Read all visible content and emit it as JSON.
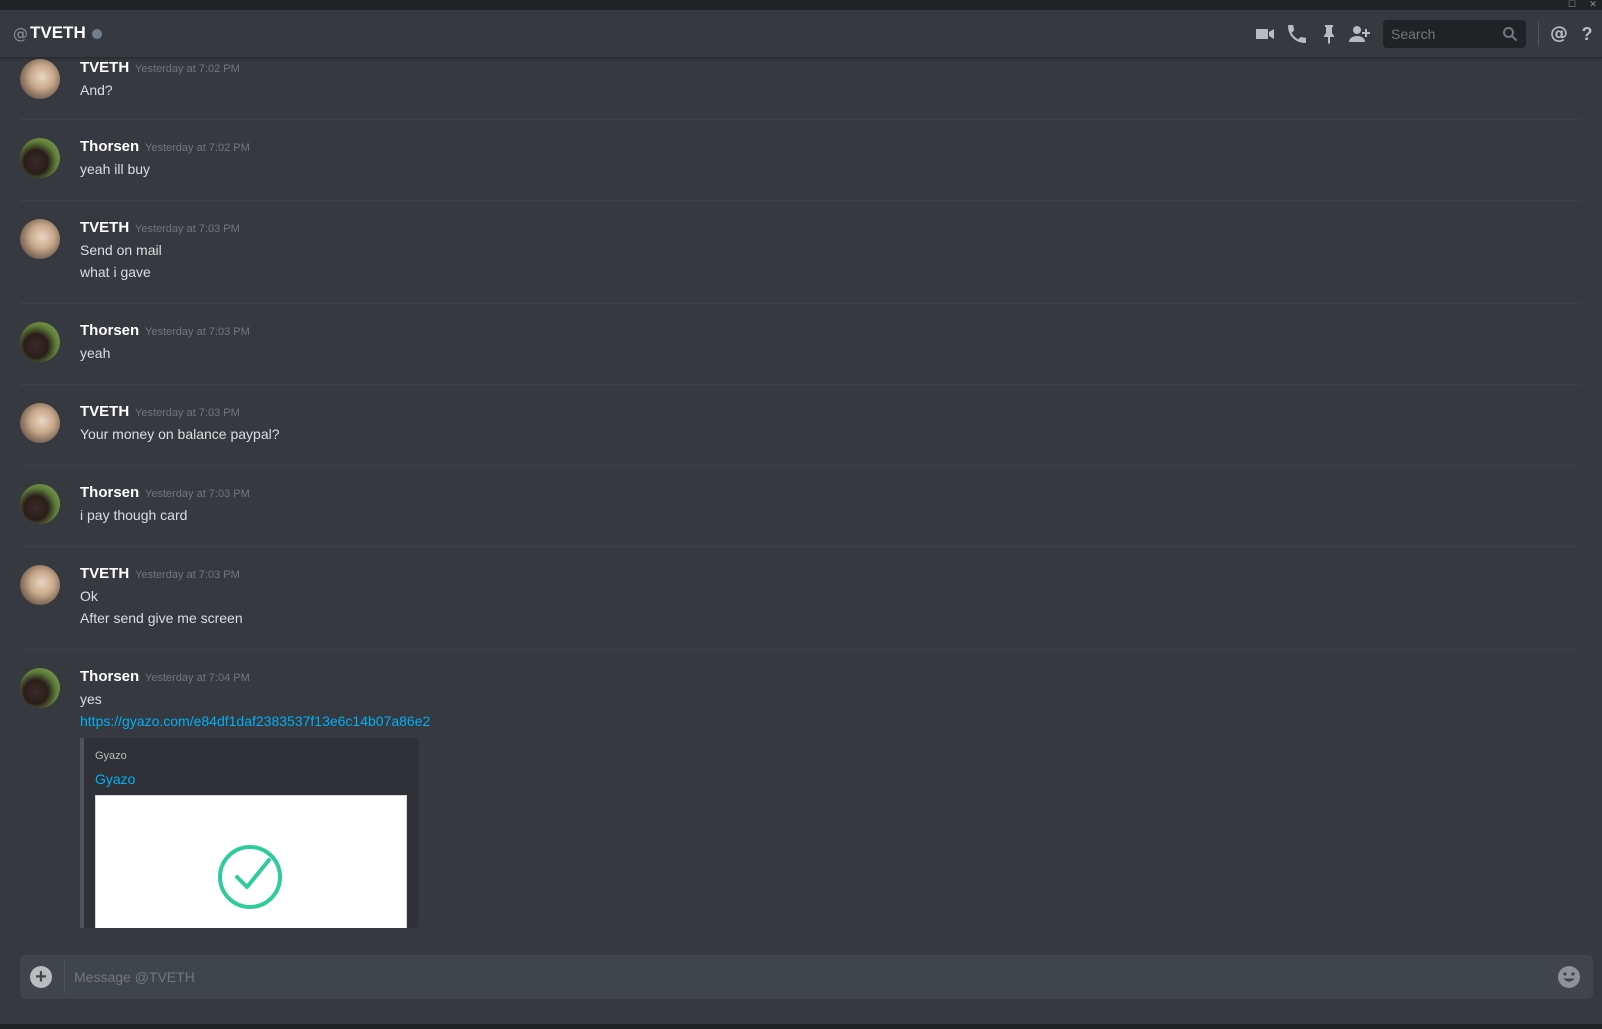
{
  "window": {
    "restore_glyph": "☐",
    "close_glyph": "✕"
  },
  "header": {
    "at_symbol": "@",
    "channel_name": "TVETH",
    "status_color": "#747f8d",
    "icons": [
      "video-call-icon",
      "voice-call-icon",
      "pin-icon",
      "add-friend-icon"
    ],
    "search_placeholder": "Search",
    "mention_symbol": "@",
    "help_symbol": "?"
  },
  "messages": [
    {
      "author": "TVETH",
      "avatar": "tveth",
      "timestamp": "Yesterday at 7:02 PM",
      "lines": [
        "And?"
      ]
    },
    {
      "author": "Thorsen",
      "avatar": "thorsen",
      "timestamp": "Yesterday at 7:02 PM",
      "lines": [
        "yeah ill buy"
      ]
    },
    {
      "author": "TVETH",
      "avatar": "tveth",
      "timestamp": "Yesterday at 7:03 PM",
      "lines": [
        "Send on mail",
        "what i gave"
      ]
    },
    {
      "author": "Thorsen",
      "avatar": "thorsen",
      "timestamp": "Yesterday at 7:03 PM",
      "lines": [
        "yeah"
      ]
    },
    {
      "author": "TVETH",
      "avatar": "tveth",
      "timestamp": "Yesterday at 7:03 PM",
      "lines": [
        "Your money on balance paypal?"
      ]
    },
    {
      "author": "Thorsen",
      "avatar": "thorsen",
      "timestamp": "Yesterday at 7:03 PM",
      "lines": [
        "i pay though card"
      ]
    },
    {
      "author": "TVETH",
      "avatar": "tveth",
      "timestamp": "Yesterday at 7:03 PM",
      "lines": [
        "Ok",
        "After send give me screen"
      ]
    },
    {
      "author": "Thorsen",
      "avatar": "thorsen",
      "timestamp": "Yesterday at 7:04 PM",
      "lines": [
        "yes"
      ],
      "link": "https://gyazo.com/e84df1daf2383537f13e6c14b07a86e2",
      "embed": {
        "provider": "Gyazo",
        "title": "Gyazo",
        "thumbnail_icon": "check-circle-icon"
      }
    }
  ],
  "composer": {
    "placeholder": "Message @TVETH",
    "plus_symbol": "+"
  },
  "colors": {
    "background": "#36393f",
    "link": "#00b0f4",
    "timestamp": "#72767d",
    "checkmark": "#2ecc9a"
  }
}
